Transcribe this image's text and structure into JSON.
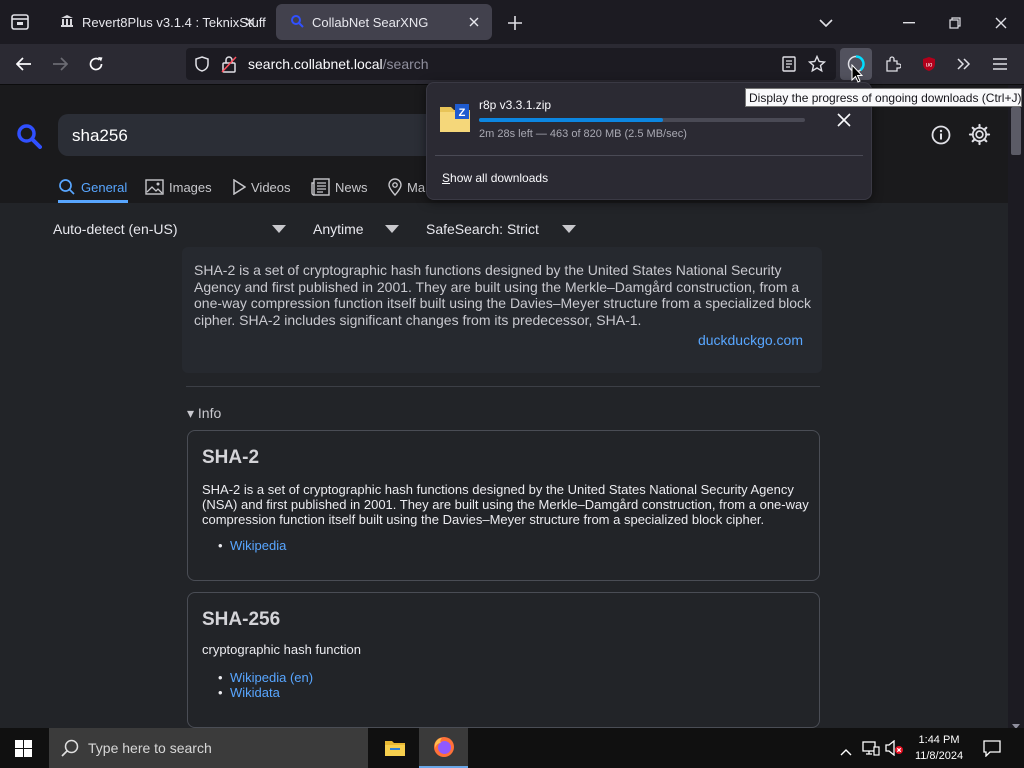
{
  "browser": {
    "tabs": [
      {
        "title": "Revert8Plus v3.1.4 : TeknixStuff"
      },
      {
        "title": "CollabNet SearXNG"
      }
    ],
    "url": {
      "host": "search.collabnet.local",
      "path": "/search"
    }
  },
  "search": {
    "query": "sha256",
    "categories": [
      "General",
      "Images",
      "Videos",
      "News",
      "Ma"
    ],
    "filters": {
      "language": "Auto-detect (en-US)",
      "time": "Anytime",
      "safesearch": "SafeSearch: Strict"
    }
  },
  "answer": {
    "text": "SHA-2 is a set of cryptographic hash functions designed by the United States National Security Agency and first published in 2001. They are built using the Merkle–Damgård construction, from a one-way compression function itself built using the Davies–Meyer structure from a specialized block cipher. SHA-2 includes significant changes from its predecessor, SHA-1.",
    "source": "duckduckgo.com"
  },
  "info": {
    "toggle_label": "▾ Info",
    "boxes": [
      {
        "title": "SHA-2",
        "description": "SHA-2 is a set of cryptographic hash functions designed by the United States National Security Agency (NSA) and first published in 2001. They are built using the Merkle–Damgård construction, from a one-way compression function itself built using the Davies–Meyer structure from a specialized block cipher.",
        "links": [
          "Wikipedia"
        ]
      },
      {
        "title": "SHA-256",
        "description": "cryptographic hash function",
        "links": [
          "Wikipedia (en)",
          "Wikidata"
        ]
      }
    ]
  },
  "downloads": {
    "file": "r8p v3.3.1.zip",
    "status": "2m 28s left — 463 of 820 MB (2.5 MB/sec)",
    "progress": 0.565,
    "show_all_underlined": "S",
    "show_all_rest": "how all downloads"
  },
  "tooltip": "Display the progress of ongoing downloads (Ctrl+J)",
  "taskbar": {
    "search_placeholder": "Type here to search",
    "time": "1:44 PM",
    "date": "11/8/2024"
  },
  "colors": {
    "accent": "#58a6ff",
    "download_progress": "#0c86e0",
    "active_tab": "#42414d"
  }
}
